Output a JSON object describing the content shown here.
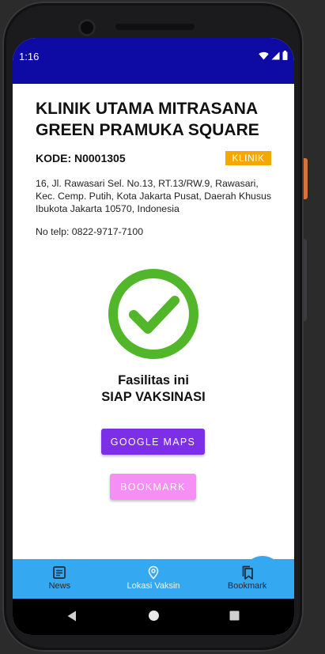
{
  "statusbar": {
    "time": "1:16",
    "icons": [
      "wifi-icon",
      "signal-icon",
      "battery-icon"
    ]
  },
  "facility": {
    "name": "KLINIK UTAMA MITRASANA GREEN PRAMUKA SQUARE",
    "code": "KODE: N0001305",
    "type_badge": "KLINIK",
    "address": "16, Jl. Rawasari Sel. No.13, RT.13/RW.9, Rawasari, Kec. Cemp. Putih, Kota Jakarta Pusat, Daerah Khusus Ibukota Jakarta 10570, Indonesia",
    "phone": "No telp: 0822-9717-7100",
    "status_icon": "check-circle-icon",
    "status_line1": "Fasilitas ini",
    "status_line2": "SIAP VAKSINASI"
  },
  "actions": {
    "maps_label": "GOOGLE MAPS",
    "bookmark_label": "BOOKMARK",
    "fab_icon": "qr-code-icon"
  },
  "bottom_nav": {
    "items": [
      {
        "label": "News",
        "icon": "news-icon"
      },
      {
        "label": "Lokasi Vaksin",
        "icon": "location-pin-icon"
      },
      {
        "label": "Bookmark",
        "icon": "bookmarks-icon"
      }
    ]
  },
  "system_nav": [
    "back-icon",
    "home-icon",
    "recents-icon"
  ],
  "colors": {
    "statusbar": "#0e0aa4",
    "badge": "#f5a700",
    "check_green": "#52b62a",
    "maps_button": "#7c2fe6",
    "bookmark_button": "#f58ef5",
    "accent_blue": "#34a9f2"
  }
}
